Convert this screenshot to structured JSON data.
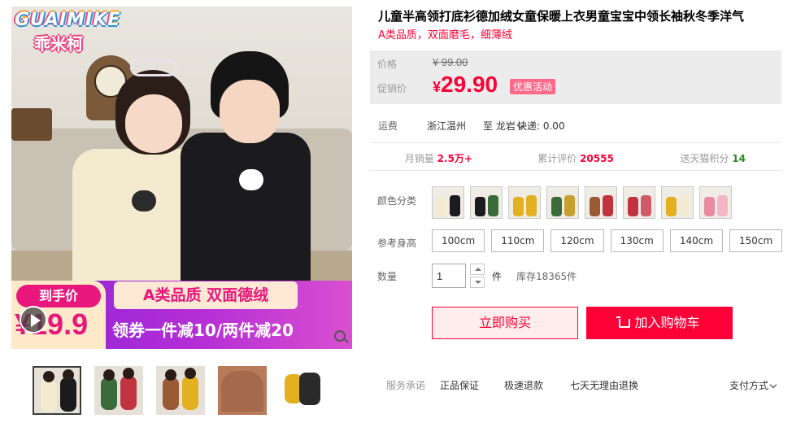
{
  "brand": {
    "logo_text_top": "GUAIMIKE",
    "logo_text_bottom": "乖米柯"
  },
  "gallery": {
    "promo": {
      "left_title": "到手价",
      "left_price": "¥19.9",
      "badge": "A类品质 双面德绒",
      "bottom_text": "领券一件减10/两件减20"
    },
    "thumbnails": [
      {
        "name": "thumb-1",
        "active": true
      },
      {
        "name": "thumb-2",
        "active": false
      },
      {
        "name": "thumb-3",
        "active": false
      },
      {
        "name": "thumb-4",
        "active": false
      },
      {
        "name": "thumb-5",
        "active": false
      }
    ]
  },
  "product": {
    "title": "儿童半高领打底衫德加绒女童保暖上衣男童宝宝中领长袖秋冬季洋气",
    "subtitle": "A类品质，双面磨毛，细薄绒",
    "price": {
      "label": "价格",
      "original": "¥ 99.00"
    },
    "promo_price": {
      "label": "促销价",
      "currency": "¥",
      "value": "29.90",
      "tag": "优惠活动"
    },
    "shipping": {
      "label": "运费",
      "from": "浙江温州",
      "to_prefix": "至",
      "to": "龙岩",
      "fee": "快递: 0.00"
    },
    "stats": {
      "monthly_sales_label": "月销量",
      "monthly_sales_value": "2.5万+",
      "reviews_label": "累计评价",
      "reviews_value": "20555",
      "points_label": "送天猫积分",
      "points_value": "14"
    },
    "color": {
      "label": "颜色分类",
      "swatch_count": 8
    },
    "size": {
      "label": "参考身高",
      "options": [
        "100cm",
        "110cm",
        "120cm",
        "130cm",
        "140cm",
        "150cm"
      ]
    },
    "quantity": {
      "label": "数量",
      "value": "1",
      "unit": "件",
      "stock": "库存18365件"
    },
    "actions": {
      "buy_now": "立即购买",
      "add_to_cart": "加入购物车"
    },
    "service": {
      "label": "服务承诺",
      "items": [
        "正品保证",
        "极速退款",
        "七天无理由退换"
      ],
      "payment": "支付方式"
    }
  },
  "colors": {
    "accent": "#ff0036",
    "promo_tag": "#ff6a8b",
    "points_green": "#2a8c1e"
  }
}
